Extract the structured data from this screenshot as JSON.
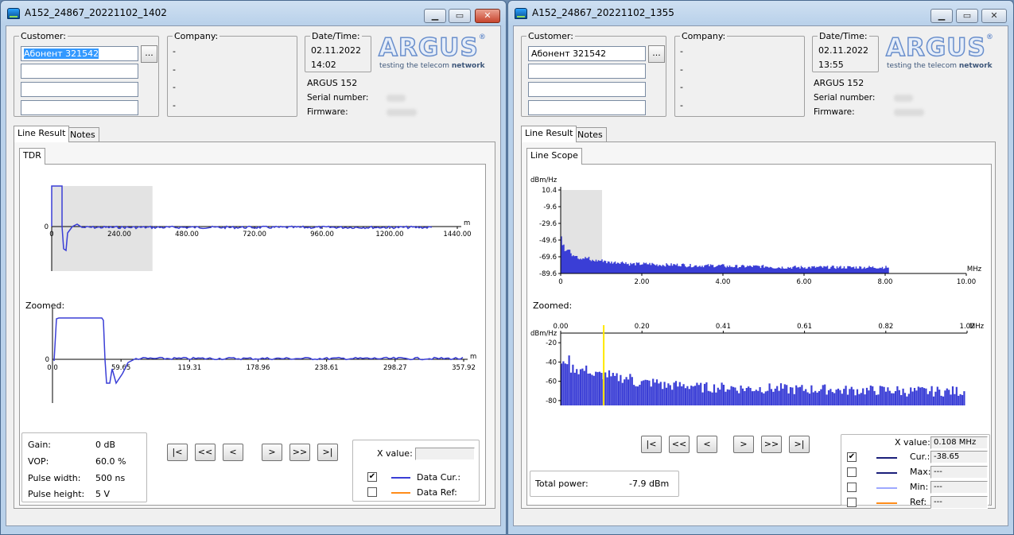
{
  "colors": {
    "trace": "#3a3ed6",
    "trace_dark": "#1b1f7a",
    "ref": "#ff8c1a",
    "max": "#1b1f7a",
    "min": "#9ea8ff",
    "marker": "#ffe800",
    "zoomband": "#e3e3e3"
  },
  "left": {
    "title": "A152_24867_20221102_1402",
    "customer": {
      "label": "Customer:",
      "value": "Абонент 321542",
      "browse": "..."
    },
    "company": {
      "label": "Company:",
      "lines": [
        "-",
        "-",
        "-",
        "-"
      ]
    },
    "datetime": {
      "label": "Date/Time:",
      "date": "02.11.2022",
      "time": "14:02"
    },
    "logo": {
      "brand": "ARGUS",
      "reg": "®",
      "slogan_pre": "testing ",
      "slogan_mid": "the telecom ",
      "slogan_post": "network"
    },
    "device": {
      "model": "ARGUS 152",
      "serial_label": "Serial number:",
      "firmware_label": "Firmware:"
    },
    "tabs": [
      "Line Result",
      "Notes"
    ],
    "subtab": "TDR",
    "zoomed_label": "Zoomed:",
    "params": [
      {
        "label": "Gain:",
        "value": "0 dB"
      },
      {
        "label": "VOP:",
        "value": "60.0 %"
      },
      {
        "label": "Pulse width:",
        "value": "500 ns"
      },
      {
        "label": "Pulse height:",
        "value": "5 V"
      }
    ],
    "nav": [
      "|<",
      "<<",
      "<",
      ">",
      ">>",
      ">|"
    ],
    "xvalue_label": "X value:",
    "xvalue": "",
    "legend": [
      {
        "label": "Data Cur.:",
        "checked": true,
        "check": "✔"
      },
      {
        "label": "Data Ref:",
        "checked": false,
        "check": ""
      }
    ]
  },
  "right": {
    "title": "A152_24867_20221102_1355",
    "customer": {
      "label": "Customer:",
      "value": "Абонент 321542",
      "browse": "..."
    },
    "company": {
      "label": "Company:",
      "lines": [
        "-",
        "-",
        "-",
        "-"
      ]
    },
    "datetime": {
      "label": "Date/Time:",
      "date": "02.11.2022",
      "time": "13:55"
    },
    "logo": {
      "brand": "ARGUS",
      "reg": "®",
      "slogan_pre": "testing ",
      "slogan_mid": "the telecom ",
      "slogan_post": "network"
    },
    "device": {
      "model": "ARGUS 152",
      "serial_label": "Serial number:",
      "firmware_label": "Firmware:"
    },
    "tabs": [
      "Line Result",
      "Notes"
    ],
    "subtab": "Line Scope",
    "zoomed_label": "Zoomed:",
    "total_power": {
      "label": "Total power:",
      "value": "-7.9 dBm"
    },
    "nav": [
      "|<",
      "<<",
      "<",
      ">",
      ">>",
      ">|"
    ],
    "xvalue_label": "X value:",
    "xvalue": "0.108 MHz",
    "legend": [
      {
        "label": "Cur.:",
        "value": "-38.65",
        "checked": true,
        "check": "✔"
      },
      {
        "label": "Max:",
        "value": "---",
        "checked": false,
        "check": ""
      },
      {
        "label": "Min:",
        "value": "---",
        "checked": false,
        "check": ""
      },
      {
        "label": "Ref:",
        "value": "---",
        "checked": false,
        "check": ""
      }
    ]
  },
  "chart_data": [
    {
      "type": "line",
      "name": "tdr-overview",
      "xlabel": "m",
      "ylabel": "",
      "xlim": [
        0,
        1440
      ],
      "x_ticks": [
        "0",
        "240.00",
        "480.00",
        "720.00",
        "960.00",
        "1200.00",
        "1440.00"
      ],
      "y_ticks": [
        "0"
      ],
      "zoom_region": [
        0,
        357.92
      ],
      "series": [
        {
          "name": "Data Cur.:",
          "trace_end": 1350
        }
      ]
    },
    {
      "type": "line",
      "name": "tdr-zoomed",
      "xlabel": "m",
      "ylabel": "",
      "xlim": [
        0,
        357.92
      ],
      "x_ticks": [
        "0.0",
        "59.65",
        "119.31",
        "178.96",
        "238.61",
        "298.27",
        "357.92"
      ],
      "y_ticks": [
        "0"
      ],
      "series": [
        {
          "name": "Data Cur.:"
        }
      ]
    },
    {
      "type": "bar",
      "name": "linescope-overview",
      "xlabel": "MHz",
      "ylabel": "dBm/Hz",
      "xlim": [
        0,
        10
      ],
      "ylim": [
        -89.6,
        10.4
      ],
      "x_ticks": [
        "0",
        "2.00",
        "4.00",
        "6.00",
        "8.00",
        "10.00"
      ],
      "y_ticks": [
        "10.4",
        "-9.6",
        "-29.6",
        "-49.6",
        "-69.6",
        "-89.6"
      ],
      "zoom_region": [
        0,
        1.02
      ],
      "series": [
        {
          "name": "Cur.:",
          "x_end": 8.1,
          "levels_dbm": [
            -30,
            -45,
            -55,
            -62,
            -68,
            -72,
            -75,
            -77,
            -79,
            -80,
            -81,
            -82,
            -83,
            -83
          ]
        }
      ]
    },
    {
      "type": "bar",
      "name": "linescope-zoomed",
      "xlabel": "MHz",
      "ylabel": "dBm/Hz",
      "xlim": [
        0,
        1.02
      ],
      "ylim": [
        -85,
        -10
      ],
      "x_ticks": [
        "0.00",
        "0.20",
        "0.41",
        "0.61",
        "0.82",
        "1.02"
      ],
      "y_ticks": [
        "-20",
        "-40",
        "-60",
        "-80"
      ],
      "marker_x": 0.108,
      "series": [
        {
          "name": "Cur.:",
          "levels_dbm": [
            -60,
            -45,
            -40,
            -48,
            -50,
            -55,
            -58,
            -63,
            -66,
            -68,
            -69,
            -70,
            -71,
            -72
          ]
        }
      ]
    }
  ]
}
